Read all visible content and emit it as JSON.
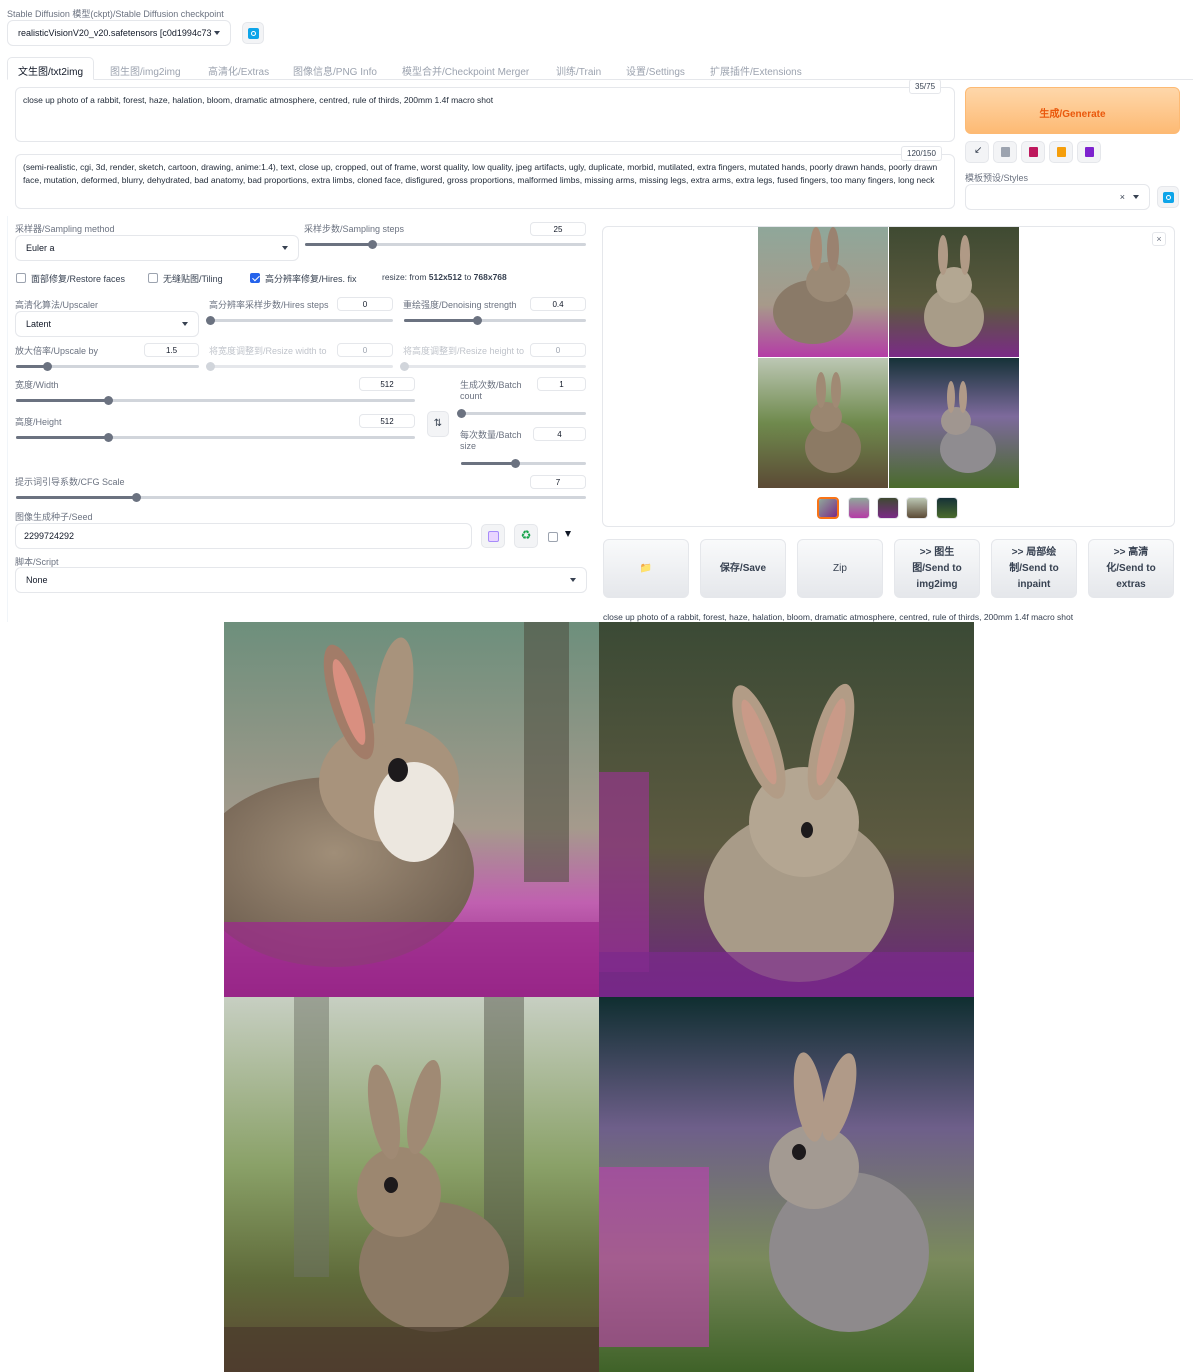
{
  "checkpoint": {
    "label": "Stable Diffusion 模型(ckpt)/Stable Diffusion checkpoint",
    "value": "realisticVisionV20_v20.safetensors [c0d1994c73"
  },
  "tabs": [
    {
      "label": "文生图/txt2img",
      "active": true
    },
    {
      "label": "图生图/img2img"
    },
    {
      "label": "高清化/Extras"
    },
    {
      "label": "图像信息/PNG Info"
    },
    {
      "label": "模型合并/Checkpoint Merger"
    },
    {
      "label": "训练/Train"
    },
    {
      "label": "设置/Settings"
    },
    {
      "label": "扩展插件/Extensions"
    }
  ],
  "prompt": {
    "text": "close up photo of a rabbit, forest, haze, halation, bloom, dramatic atmosphere, centred, rule of thirds, 200mm 1.4f macro shot",
    "token_count": "35/75"
  },
  "negative_prompt": {
    "text": "(semi-realistic, cgi, 3d, render, sketch, cartoon, drawing, anime:1.4), text, close up, cropped, out of frame, worst quality, low quality, jpeg artifacts, ugly, duplicate, morbid, mutilated, extra fingers, mutated hands, poorly drawn hands, poorly drawn face, mutation, deformed, blurry, dehydrated, bad anatomy, bad proportions, extra limbs, cloned face, disfigured, gross proportions, malformed limbs, missing arms, missing legs, extra arms, extra legs, fused fingers, too many fingers, long neck",
    "token_count": "120/150"
  },
  "generate": {
    "label": "生成/Generate"
  },
  "styles": {
    "label": "模板预设/Styles",
    "clear": "×"
  },
  "sampler": {
    "label": "采样器/Sampling method",
    "value": "Euler a"
  },
  "steps": {
    "label": "采样步数/Sampling steps",
    "value": "25",
    "fraction": 0.24
  },
  "restore_faces": {
    "label": "面部修复/Restore faces",
    "checked": false
  },
  "tiling": {
    "label": "无缝贴图/Tiling",
    "checked": false
  },
  "hires_fix": {
    "label": "高分辨率修复/Hires. fix",
    "checked": true
  },
  "resize_info": {
    "prefix": "resize: from ",
    "from": "512x512",
    "mid": " to ",
    "to": "768x768"
  },
  "upscaler": {
    "label": "高清化算法/Upscaler",
    "value": "Latent"
  },
  "hires_steps": {
    "label": "高分辨率采样步数/Hires steps",
    "value": "0",
    "fraction": 0.0
  },
  "denoising": {
    "label": "重绘强度/Denoising strength",
    "value": "0.4",
    "fraction": 0.4
  },
  "upscale_by": {
    "label": "放大倍率/Upscale by",
    "value": "1.5",
    "fraction": 0.17
  },
  "resize_width": {
    "label": "将宽度调整到/Resize width to",
    "value": "0"
  },
  "resize_height": {
    "label": "将高度调整到/Resize height to",
    "value": "0"
  },
  "width": {
    "label": "宽度/Width",
    "value": "512",
    "fraction": 0.23
  },
  "height": {
    "label": "高度/Height",
    "value": "512",
    "fraction": 0.23
  },
  "batch_count": {
    "label_1": "生成次数/Batch",
    "label_2": "count",
    "value": "1",
    "fraction": 0.0
  },
  "batch_size": {
    "label_1": "每次数量/Batch",
    "label_2": "size",
    "value": "4",
    "fraction": 0.43
  },
  "swap_icon": "swap-arrows-icon",
  "cfg": {
    "label": "提示词引导系数/CFG Scale",
    "value": "7",
    "fraction": 0.21
  },
  "seed": {
    "label": "图像生成种子/Seed",
    "value": "2299724292"
  },
  "script": {
    "label": "脚本/Script",
    "value": "None"
  },
  "actions": [
    {
      "label": "📁",
      "name": "open-folder"
    },
    {
      "label": "保存/Save",
      "name": "save"
    },
    {
      "label": "Zip",
      "name": "zip"
    },
    {
      "label": ">> 图生\n图/Send to\nimg2img",
      "name": "send-to-img2img"
    },
    {
      "label": ">> 局部绘\n制/Send to\ninpaint",
      "name": "send-to-inpaint"
    },
    {
      "label": ">> 高清\n化/Send to\nextras",
      "name": "send-to-extras"
    }
  ],
  "info_caption": "close up photo of a rabbit, forest, haze, halation, bloom, dramatic atmosphere, centred, rule of thirds, 200mm 1.4f macro shot",
  "colors": {
    "accent": "#f97316",
    "generate_bg": "#fdba74",
    "checkbox": "#2563eb",
    "tool_blue": "#0ea5e9"
  }
}
